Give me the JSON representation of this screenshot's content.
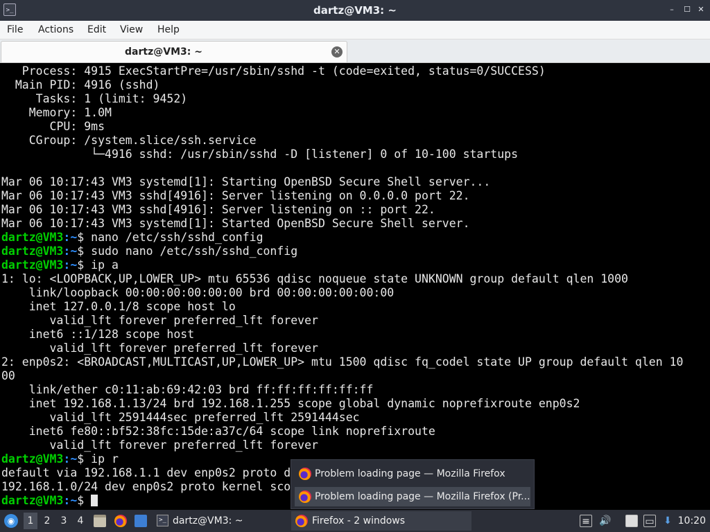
{
  "window": {
    "title": "dartz@VM3: ~",
    "app_icon": "terminal-icon",
    "controls": {
      "minimize": "–",
      "maximize": "☐",
      "close": "✕"
    }
  },
  "menu": {
    "file": "File",
    "actions": "Actions",
    "edit": "Edit",
    "view": "View",
    "help": "Help"
  },
  "tab": {
    "label": "dartz@VM3: ~",
    "close": "✕"
  },
  "terminal": {
    "prompt_user": "dartz@VM3",
    "prompt_path": ":~",
    "prompt_symbol": "$",
    "lines": [
      {
        "text": "   Process: 4915 ExecStartPre=/usr/sbin/sshd -t (code=exited, status=0/SUCCESS)"
      },
      {
        "text": "  Main PID: 4916 (sshd)"
      },
      {
        "text": "     Tasks: 1 (limit: 9452)"
      },
      {
        "text": "    Memory: 1.0M"
      },
      {
        "text": "       CPU: 9ms"
      },
      {
        "text": "    CGroup: /system.slice/ssh.service"
      },
      {
        "text": "             └─4916 sshd: /usr/sbin/sshd -D [listener] 0 of 10-100 startups"
      },
      {
        "text": ""
      },
      {
        "text": "Mar 06 10:17:43 VM3 systemd[1]: Starting OpenBSD Secure Shell server..."
      },
      {
        "text": "Mar 06 10:17:43 VM3 sshd[4916]: Server listening on 0.0.0.0 port 22."
      },
      {
        "text": "Mar 06 10:17:43 VM3 sshd[4916]: Server listening on :: port 22."
      },
      {
        "text": "Mar 06 10:17:43 VM3 systemd[1]: Started OpenBSD Secure Shell server."
      },
      {
        "prompt": true,
        "cmd": " nano /etc/ssh/sshd_config"
      },
      {
        "prompt": true,
        "cmd": " sudo nano /etc/ssh/sshd_config"
      },
      {
        "prompt": true,
        "cmd": " ip a"
      },
      {
        "text": "1: lo: <LOOPBACK,UP,LOWER_UP> mtu 65536 qdisc noqueue state UNKNOWN group default qlen 1000"
      },
      {
        "text": "    link/loopback 00:00:00:00:00:00 brd 00:00:00:00:00:00"
      },
      {
        "text": "    inet 127.0.0.1/8 scope host lo"
      },
      {
        "text": "       valid_lft forever preferred_lft forever"
      },
      {
        "text": "    inet6 ::1/128 scope host"
      },
      {
        "text": "       valid_lft forever preferred_lft forever"
      },
      {
        "text": "2: enp0s2: <BROADCAST,MULTICAST,UP,LOWER_UP> mtu 1500 qdisc fq_codel state UP group default qlen 10"
      },
      {
        "text": "00"
      },
      {
        "text": "    link/ether c0:11:ab:69:42:03 brd ff:ff:ff:ff:ff:ff"
      },
      {
        "text": "    inet 192.168.1.13/24 brd 192.168.1.255 scope global dynamic noprefixroute enp0s2"
      },
      {
        "text": "       valid_lft 2591444sec preferred_lft 2591444sec"
      },
      {
        "text": "    inet6 fe80::bf52:38fc:15de:a37c/64 scope link noprefixroute"
      },
      {
        "text": "       valid_lft forever preferred_lft forever"
      },
      {
        "prompt": true,
        "cmd": " ip r"
      },
      {
        "text": "default via 192.168.1.1 dev enp0s2 proto d"
      },
      {
        "text": "192.168.1.0/24 dev enp0s2 proto kernel sco"
      },
      {
        "prompt": true,
        "cmd": " ",
        "cursor": true
      }
    ]
  },
  "popup": {
    "items": [
      {
        "label": "Problem loading page — Mozilla Firefox",
        "icon": "firefox-icon"
      },
      {
        "label": "Problem loading page — Mozilla Firefox (Pr...",
        "icon": "firefox-icon",
        "selected": true
      }
    ]
  },
  "taskbar": {
    "menu_icon": "start-menu-icon",
    "workspaces": [
      "1",
      "2",
      "3",
      "4"
    ],
    "active_workspace": "1",
    "launchers": [
      "file-manager-icon",
      "firefox-icon",
      "show-desktop-icon"
    ],
    "tasks": {
      "terminal": "dartz@VM3: ~",
      "firefox": "Firefox - 2 windows"
    },
    "tray": [
      "notes-icon",
      "volume-icon",
      "clipboard-icon",
      "network-icon",
      "update-icon"
    ],
    "clock": "10:20"
  },
  "colors": {
    "terminal_bg": "#000000",
    "terminal_fg": "#e8e8e8",
    "prompt_user": "#00d000",
    "prompt_path": "#2e8fff",
    "panel_bg": "#2b2e37",
    "titlebar_bg": "#2f343f"
  }
}
